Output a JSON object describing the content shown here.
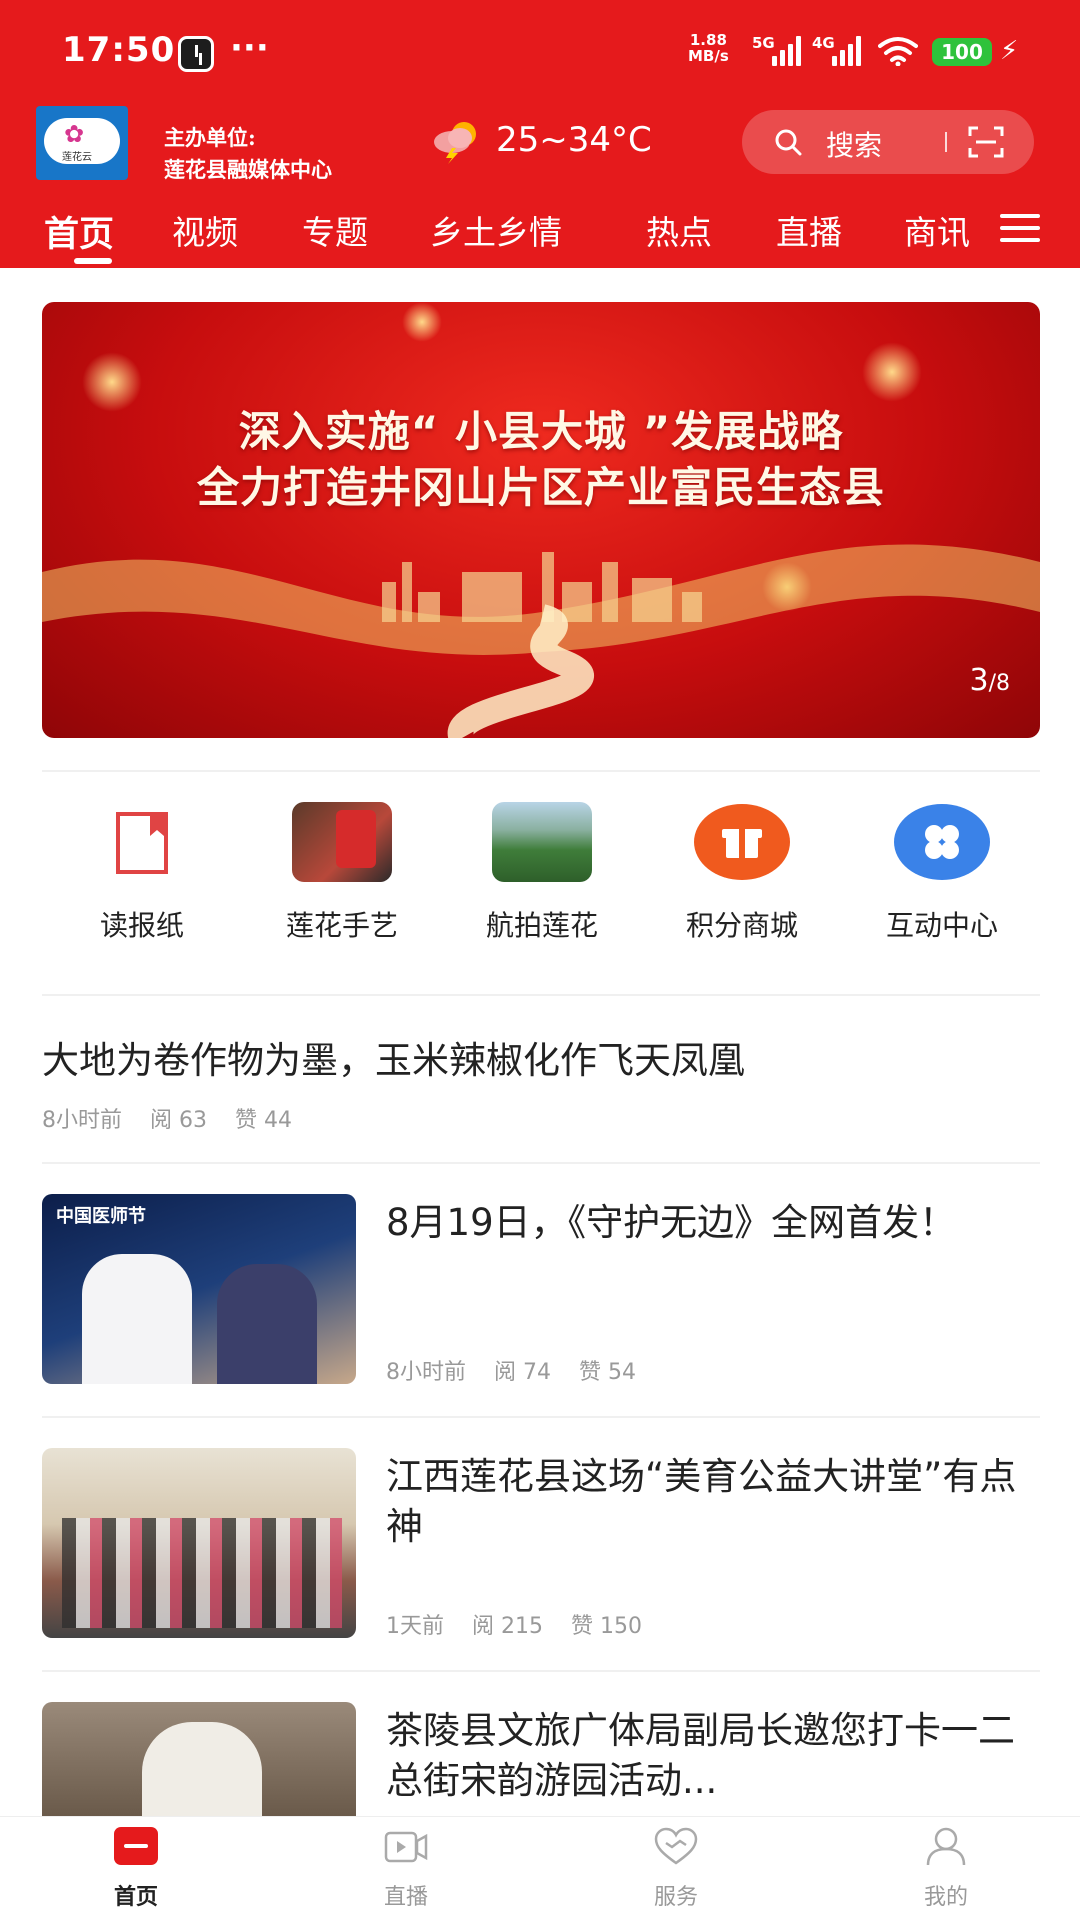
{
  "status": {
    "time": "17:50",
    "dots": "···",
    "speed_value": "1.88",
    "speed_unit": "MB/s",
    "net1": "5G",
    "net2": "4G",
    "battery": "100"
  },
  "header": {
    "logo_text": "莲花云",
    "host_label": "主办单位:",
    "host_name": "莲花县融媒体中心",
    "weather": "25~34°C",
    "search_label": "搜索"
  },
  "tabs": [
    "首页",
    "视频",
    "专题",
    "乡土乡情",
    "热点",
    "直播",
    "商讯"
  ],
  "banner": {
    "line1": "深入实施“ 小县大城 ”发展战略",
    "line2": "全力打造井冈山片区产业富民生态县",
    "current": "3",
    "total": "/8"
  },
  "quick_entries": [
    {
      "label": "读报纸",
      "icon": "newspaper-icon"
    },
    {
      "label": "莲花手艺",
      "icon": "handicraft-icon"
    },
    {
      "label": "航拍莲花",
      "icon": "aerial-photo-icon"
    },
    {
      "label": "积分商城",
      "icon": "gift-icon"
    },
    {
      "label": "互动中心",
      "icon": "interaction-icon"
    }
  ],
  "news": [
    {
      "title": "大地为卷作物为墨，玉米辣椒化作飞天凤凰",
      "time": "8小时前",
      "reads": "阅 63",
      "likes": "赞 44"
    },
    {
      "title": "8月19日，《守护无边》全网首发！",
      "time": "8小时前",
      "reads": "阅 74",
      "likes": "赞 54",
      "thumb_caption": "中国医师节"
    },
    {
      "title": "江西莲花县这场“美育公益大讲堂”有点神",
      "time": "1天前",
      "reads": "阅 215",
      "likes": "赞 150"
    },
    {
      "title": "茶陵县文旅广体局副局长邀您打卡一二总街宋韵游园活动...",
      "time": "",
      "reads": "",
      "likes": ""
    }
  ],
  "bottom_nav": [
    {
      "label": "首页",
      "icon": "home-icon"
    },
    {
      "label": "直播",
      "icon": "live-icon"
    },
    {
      "label": "服务",
      "icon": "service-heart-icon"
    },
    {
      "label": "我的",
      "icon": "profile-icon"
    }
  ],
  "colors": {
    "brand_red": "#e51a1c",
    "text": "#222222",
    "meta": "#999999"
  }
}
